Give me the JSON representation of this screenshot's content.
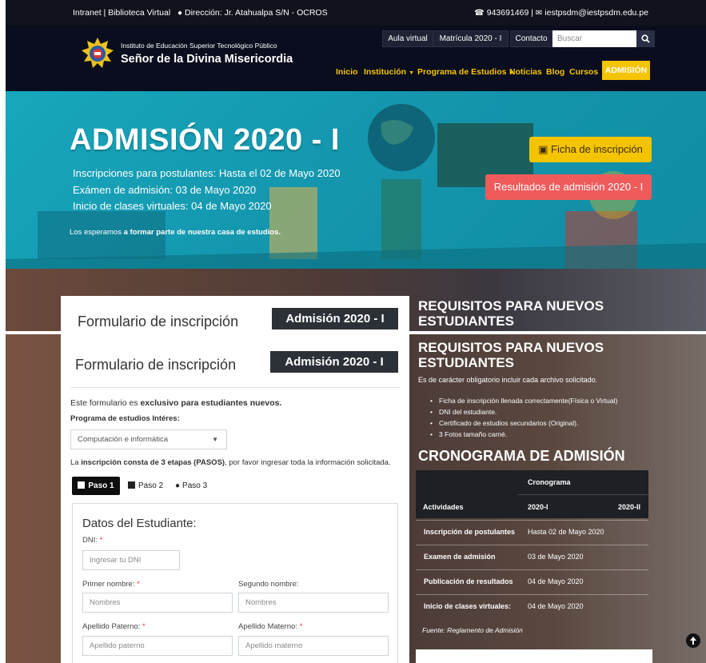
{
  "topbar": {
    "links": "Intranet | Biblioteca Virtual",
    "address": "Dirección: Jr. Atahualpa S/N - OCROS",
    "phone": "943691469 |",
    "email": "iestpsdm@iestpsdm.edu.pe"
  },
  "header": {
    "inst_small": "Instituto de Educación Superior Tecnológico Público",
    "inst_big": "Señor de la Divina Misericordia",
    "aula": "Aula virtual",
    "matricula": "Matrícula 2020 - I",
    "contacto": "Contacto",
    "search_placeholder": "Buscar",
    "nav": {
      "inicio": "Inicio",
      "institucion": "Institución",
      "programa": "Programa de Estudios",
      "noticias": "Noticias",
      "blog": "Blog",
      "cursos": "Cursos",
      "admision": "ADMISIÓN"
    }
  },
  "hero": {
    "title": "ADMISIÓN 2020 - I",
    "line1": "Inscripciones para postulantes: Hasta el 02 de Mayo 2020",
    "line2": "Exámen de admisión: 03 de Mayo 2020",
    "line3": "Inicio de clases virtuales: 04 de Mayo 2020",
    "small_pre": "Los esperamos",
    "small_bold": "a formar parte de nuestra casa de estudios.",
    "btn_ficha": "Ficha de inscripción",
    "btn_result": "Resultados de admisión 2020 - I"
  },
  "form": {
    "title": "Formulario de inscripción",
    "badge": "Admisión 2020 - I",
    "intro_pre": "Este formulario es",
    "intro_bold": "exclusivo para estudiantes nuevos.",
    "programa_label": "Programa de estudios Intéres:",
    "programa_value": "Computación e informática",
    "etapas_pre": "La",
    "etapas_bold": "inscripción consta de 3 etapas (PASOS)",
    "etapas_post": ", por favor ingresar toda la información solicitada.",
    "tabs": [
      "Paso 1",
      "Paso 2",
      "Paso 3"
    ],
    "datos_title": "Datos del Estudiante:",
    "dni_label": "DNI:",
    "dni_ph": "Ingresar tu DNI",
    "pnombre_label": "Primer nombre:",
    "pnombre_ph": "Nombres",
    "snombre_label": "Segundo nombre:",
    "snombre_ph": "Nombres",
    "apaterno_label": "Apellido Paterno:",
    "apaterno_ph": "Apellido paterno",
    "amaterno_label": "Apellido Materno:",
    "amaterno_ph": "Apellido materno",
    "required_mark": "*"
  },
  "requisitos": {
    "title_line1": "REQUISITOS PARA NUEVOS",
    "title_line2": "ESTUDIANTES",
    "intro": "Es de carácter obligatorio incluir cada archivo solicitado.",
    "items": [
      "Ficha de inscripción llenada correctamente(Física o Virtual)",
      "DNI del estudiante.",
      "Certificado de estudios secundarios (Original).",
      "3 Fotos tamaño carné."
    ]
  },
  "cronograma": {
    "title": "CRONOGRAMA DE ADMISIÓN",
    "head_group": "Cronograma",
    "col_act": "Actividades",
    "col_a": "2020-I",
    "col_b": "2020-II",
    "rows": [
      {
        "act": "Inscripción de postulantes",
        "a": "Hasta 02 de Mayo 2020"
      },
      {
        "act": "Examen de admisión",
        "a": "03 de Mayo 2020"
      },
      {
        "act": "Publicación de resultados",
        "a": "04 de Mayo 2020"
      },
      {
        "act": "Inicio de clases virtuales:",
        "a": "04 de Mayo 2020"
      }
    ],
    "fuente": "Fuente: Reglamento de Admisión"
  },
  "colors": {
    "accent_yellow": "#f5c400",
    "accent_red": "#ef5b5b",
    "header_dark": "#0a0d1d",
    "hero_teal": "#17a7bd"
  }
}
